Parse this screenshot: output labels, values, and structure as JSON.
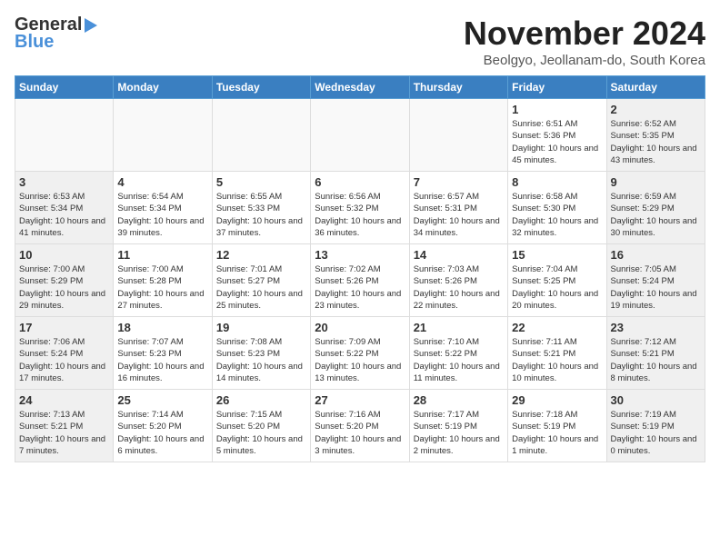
{
  "header": {
    "logo_line1": "General",
    "logo_line2": "Blue",
    "month": "November 2024",
    "location": "Beolgyo, Jeollanam-do, South Korea"
  },
  "days_of_week": [
    "Sunday",
    "Monday",
    "Tuesday",
    "Wednesday",
    "Thursday",
    "Friday",
    "Saturday"
  ],
  "weeks": [
    [
      {
        "day": "",
        "info": ""
      },
      {
        "day": "",
        "info": ""
      },
      {
        "day": "",
        "info": ""
      },
      {
        "day": "",
        "info": ""
      },
      {
        "day": "",
        "info": ""
      },
      {
        "day": "1",
        "info": "Sunrise: 6:51 AM\nSunset: 5:36 PM\nDaylight: 10 hours and 45 minutes."
      },
      {
        "day": "2",
        "info": "Sunrise: 6:52 AM\nSunset: 5:35 PM\nDaylight: 10 hours and 43 minutes."
      }
    ],
    [
      {
        "day": "3",
        "info": "Sunrise: 6:53 AM\nSunset: 5:34 PM\nDaylight: 10 hours and 41 minutes."
      },
      {
        "day": "4",
        "info": "Sunrise: 6:54 AM\nSunset: 5:34 PM\nDaylight: 10 hours and 39 minutes."
      },
      {
        "day": "5",
        "info": "Sunrise: 6:55 AM\nSunset: 5:33 PM\nDaylight: 10 hours and 37 minutes."
      },
      {
        "day": "6",
        "info": "Sunrise: 6:56 AM\nSunset: 5:32 PM\nDaylight: 10 hours and 36 minutes."
      },
      {
        "day": "7",
        "info": "Sunrise: 6:57 AM\nSunset: 5:31 PM\nDaylight: 10 hours and 34 minutes."
      },
      {
        "day": "8",
        "info": "Sunrise: 6:58 AM\nSunset: 5:30 PM\nDaylight: 10 hours and 32 minutes."
      },
      {
        "day": "9",
        "info": "Sunrise: 6:59 AM\nSunset: 5:29 PM\nDaylight: 10 hours and 30 minutes."
      }
    ],
    [
      {
        "day": "10",
        "info": "Sunrise: 7:00 AM\nSunset: 5:29 PM\nDaylight: 10 hours and 29 minutes."
      },
      {
        "day": "11",
        "info": "Sunrise: 7:00 AM\nSunset: 5:28 PM\nDaylight: 10 hours and 27 minutes."
      },
      {
        "day": "12",
        "info": "Sunrise: 7:01 AM\nSunset: 5:27 PM\nDaylight: 10 hours and 25 minutes."
      },
      {
        "day": "13",
        "info": "Sunrise: 7:02 AM\nSunset: 5:26 PM\nDaylight: 10 hours and 23 minutes."
      },
      {
        "day": "14",
        "info": "Sunrise: 7:03 AM\nSunset: 5:26 PM\nDaylight: 10 hours and 22 minutes."
      },
      {
        "day": "15",
        "info": "Sunrise: 7:04 AM\nSunset: 5:25 PM\nDaylight: 10 hours and 20 minutes."
      },
      {
        "day": "16",
        "info": "Sunrise: 7:05 AM\nSunset: 5:24 PM\nDaylight: 10 hours and 19 minutes."
      }
    ],
    [
      {
        "day": "17",
        "info": "Sunrise: 7:06 AM\nSunset: 5:24 PM\nDaylight: 10 hours and 17 minutes."
      },
      {
        "day": "18",
        "info": "Sunrise: 7:07 AM\nSunset: 5:23 PM\nDaylight: 10 hours and 16 minutes."
      },
      {
        "day": "19",
        "info": "Sunrise: 7:08 AM\nSunset: 5:23 PM\nDaylight: 10 hours and 14 minutes."
      },
      {
        "day": "20",
        "info": "Sunrise: 7:09 AM\nSunset: 5:22 PM\nDaylight: 10 hours and 13 minutes."
      },
      {
        "day": "21",
        "info": "Sunrise: 7:10 AM\nSunset: 5:22 PM\nDaylight: 10 hours and 11 minutes."
      },
      {
        "day": "22",
        "info": "Sunrise: 7:11 AM\nSunset: 5:21 PM\nDaylight: 10 hours and 10 minutes."
      },
      {
        "day": "23",
        "info": "Sunrise: 7:12 AM\nSunset: 5:21 PM\nDaylight: 10 hours and 8 minutes."
      }
    ],
    [
      {
        "day": "24",
        "info": "Sunrise: 7:13 AM\nSunset: 5:21 PM\nDaylight: 10 hours and 7 minutes."
      },
      {
        "day": "25",
        "info": "Sunrise: 7:14 AM\nSunset: 5:20 PM\nDaylight: 10 hours and 6 minutes."
      },
      {
        "day": "26",
        "info": "Sunrise: 7:15 AM\nSunset: 5:20 PM\nDaylight: 10 hours and 5 minutes."
      },
      {
        "day": "27",
        "info": "Sunrise: 7:16 AM\nSunset: 5:20 PM\nDaylight: 10 hours and 3 minutes."
      },
      {
        "day": "28",
        "info": "Sunrise: 7:17 AM\nSunset: 5:19 PM\nDaylight: 10 hours and 2 minutes."
      },
      {
        "day": "29",
        "info": "Sunrise: 7:18 AM\nSunset: 5:19 PM\nDaylight: 10 hours and 1 minute."
      },
      {
        "day": "30",
        "info": "Sunrise: 7:19 AM\nSunset: 5:19 PM\nDaylight: 10 hours and 0 minutes."
      }
    ]
  ]
}
